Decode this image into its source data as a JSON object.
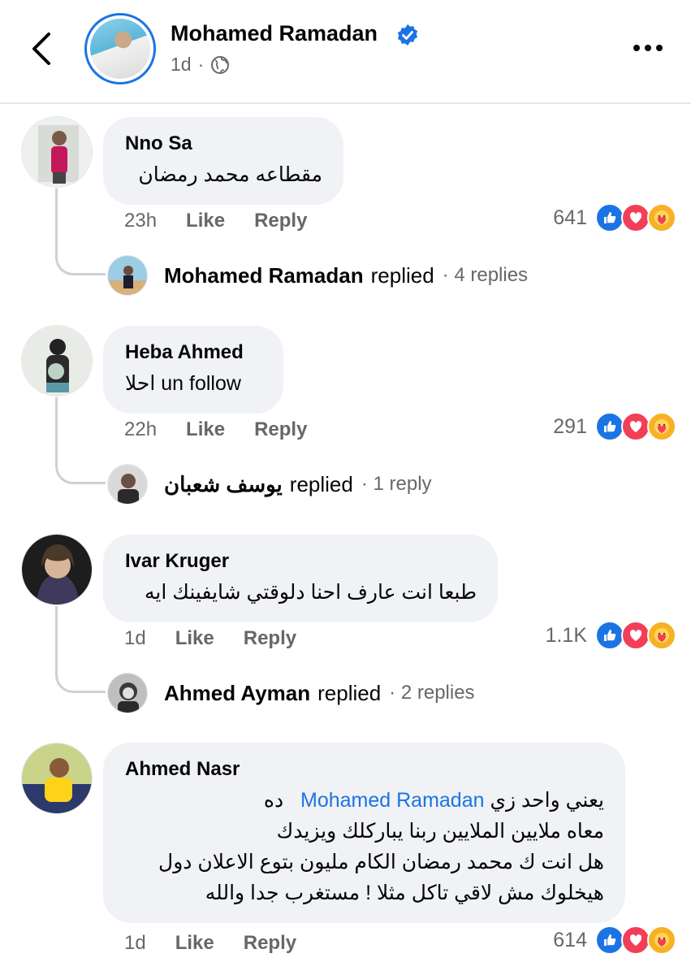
{
  "header": {
    "page_name": "Mohamed Ramadan",
    "time": "1d",
    "separator": "·"
  },
  "comments": [
    {
      "author": "Nno Sa",
      "text": "مقطاعه محمد رمضان",
      "time": "23h",
      "like_label": "Like",
      "reply_label": "Reply",
      "reaction_count": "641",
      "reply_summary": {
        "name": "Mohamed Ramadan",
        "action": "replied",
        "count": "· 4 replies"
      }
    },
    {
      "author": "Heba Ahmed",
      "text": "احلا un follow",
      "time": "22h",
      "like_label": "Like",
      "reply_label": "Reply",
      "reaction_count": "291",
      "reply_summary": {
        "name": "يوسف شعبان",
        "action": "replied",
        "count": "· 1 reply"
      }
    },
    {
      "author": "Ivar Kruger",
      "text": "طبعا انت عارف احنا دلوقتي شايفينك ايه",
      "time": "1d",
      "like_label": "Like",
      "reply_label": "Reply",
      "reaction_count": "1.1K",
      "reply_summary": {
        "name": "Ahmed Ayman",
        "action": "replied",
        "count": "· 2 replies"
      }
    },
    {
      "author": "Ahmed Nasr",
      "text_prefix": "يعني واحد زي",
      "mention": "Mohamed Ramadan",
      "text_suffix": "ده",
      "text_lines": [
        "معاه ملايين الملايين ربنا يباركلك ويزيدك",
        "هل انت ك محمد رمضان الكام مليون بتوع الاعلان دول",
        "هيخلوك مش لاقي تاكل مثلا ! مستغرب جدا والله"
      ],
      "time": "1d",
      "like_label": "Like",
      "reply_label": "Reply",
      "reaction_count": "614"
    }
  ],
  "colors": {
    "accent": "#1b74e4",
    "love": "#f33e58",
    "care": "#f7b125",
    "bubble": "#f0f2f5",
    "secondary_text": "#65676b"
  },
  "icons": [
    "back-arrow-icon",
    "verified-badge-icon",
    "globe-icon",
    "more-icon",
    "like-reaction-icon",
    "love-reaction-icon",
    "care-reaction-icon"
  ]
}
